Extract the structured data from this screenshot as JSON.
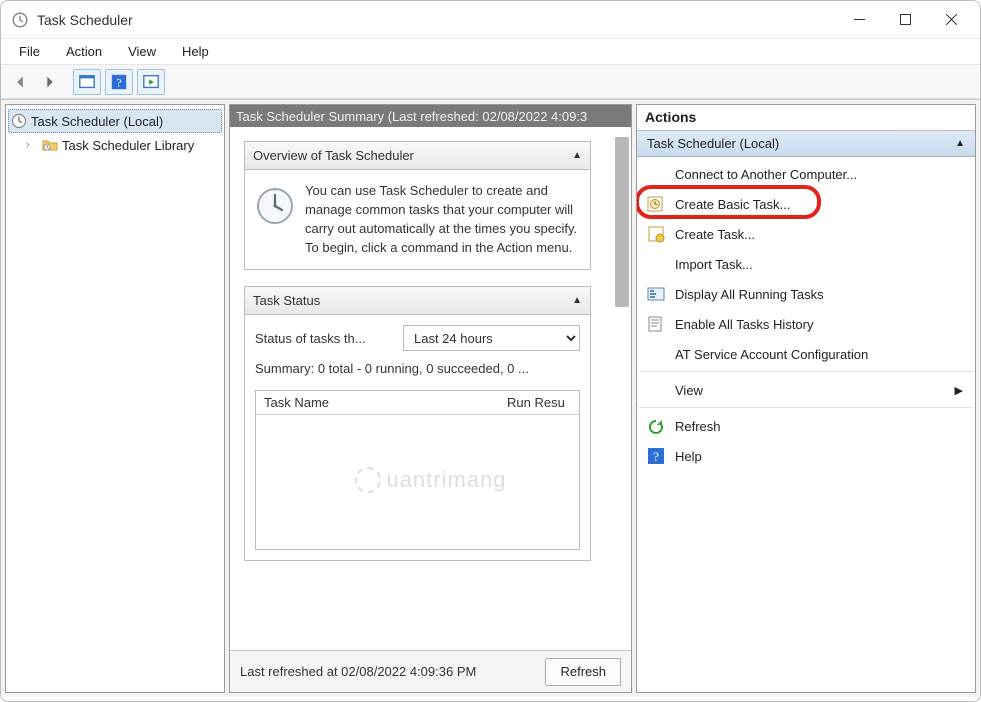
{
  "window": {
    "title": "Task Scheduler"
  },
  "menu": {
    "items": [
      "File",
      "Action",
      "View",
      "Help"
    ]
  },
  "tree": {
    "root_label": "Task Scheduler (Local)",
    "library_label": "Task Scheduler Library"
  },
  "center": {
    "header": "Task Scheduler Summary (Last refreshed: 02/08/2022 4:09:3",
    "overview_title": "Overview of Task Scheduler",
    "overview_text": "You can use Task Scheduler to create and manage common tasks that your computer will carry out automatically at the times you specify. To begin, click a command in the Action menu.",
    "status_title": "Task Status",
    "status_label": "Status of tasks th...",
    "status_select_value": "Last 24 hours",
    "summary_line": "Summary: 0 total - 0 running, 0 succeeded, 0 ...",
    "table_cols": {
      "name": "Task Name",
      "run": "Run Resu"
    },
    "footer_text": "Last refreshed at 02/08/2022 4:09:36 PM",
    "refresh_label": "Refresh"
  },
  "actions": {
    "title": "Actions",
    "context": "Task Scheduler (Local)",
    "items": [
      {
        "id": "connect",
        "label": "Connect to Another Computer...",
        "icon": "none"
      },
      {
        "id": "create-basic",
        "label": "Create Basic Task...",
        "icon": "basic",
        "highlighted": true
      },
      {
        "id": "create-task",
        "label": "Create Task...",
        "icon": "task"
      },
      {
        "id": "import",
        "label": "Import Task...",
        "icon": "none"
      },
      {
        "id": "display-running",
        "label": "Display All Running Tasks",
        "icon": "running"
      },
      {
        "id": "enable-history",
        "label": "Enable All Tasks History",
        "icon": "history"
      },
      {
        "id": "at-config",
        "label": "AT Service Account Configuration",
        "icon": "none"
      },
      {
        "id": "view",
        "label": "View",
        "icon": "none",
        "submenu": true,
        "sep": true
      },
      {
        "id": "refresh",
        "label": "Refresh",
        "icon": "refresh",
        "sep": true
      },
      {
        "id": "help",
        "label": "Help",
        "icon": "help"
      }
    ]
  },
  "watermark": "uantrimang"
}
